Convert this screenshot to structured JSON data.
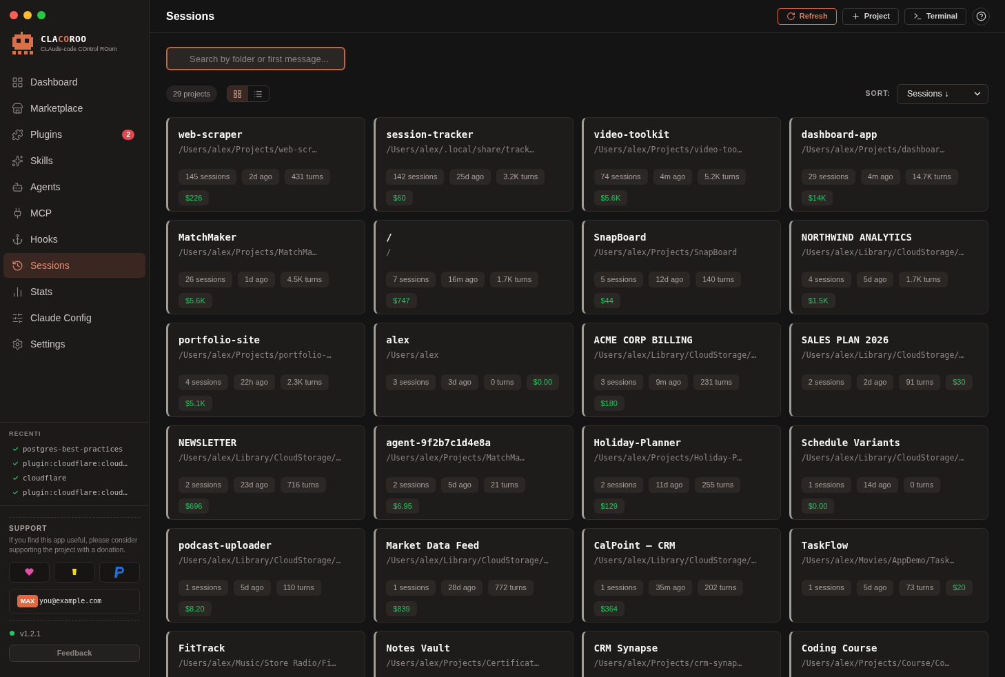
{
  "app": {
    "title_parts": [
      {
        "text": "CLA",
        "accent": false
      },
      {
        "text": "CO",
        "accent": true
      },
      {
        "text": "ROO",
        "accent": false
      }
    ],
    "subtitle": "CLAude-code COntrol ROom"
  },
  "sidebar": {
    "items": [
      {
        "label": "Dashboard",
        "selected": false
      },
      {
        "label": "Marketplace",
        "selected": false
      },
      {
        "label": "Plugins",
        "selected": false,
        "badge": "2"
      },
      {
        "label": "Skills",
        "selected": false
      },
      {
        "label": "Agents",
        "selected": false
      },
      {
        "label": "MCP",
        "selected": false
      },
      {
        "label": "Hooks",
        "selected": false
      },
      {
        "label": "Sessions",
        "selected": true
      },
      {
        "label": "Stats",
        "selected": false
      },
      {
        "label": "Claude Config",
        "selected": false
      },
      {
        "label": "Settings",
        "selected": false
      }
    ],
    "recent": {
      "title": "RECENTI",
      "items": [
        "postgres-best-practices",
        "plugin:cloudflare:cloud…",
        "cloudflare",
        "plugin:cloudflare:cloud…"
      ]
    },
    "support": {
      "title": "SUPPORT",
      "text": "If you find this app useful, please consider supporting the project with a donation."
    },
    "account": {
      "plan": "MAX",
      "email": "you@example.com"
    },
    "version": "v1.2.1",
    "feedback": "Feedback"
  },
  "header": {
    "title": "Sessions",
    "buttons": [
      {
        "label": "Refresh",
        "kind": "refresh"
      },
      {
        "label": "Project",
        "kind": "add"
      },
      {
        "label": "Terminal",
        "kind": "terminal"
      }
    ]
  },
  "search": {
    "placeholder": "Search by folder or first message..."
  },
  "toolbar": {
    "count": "29 projects",
    "views": [
      {
        "kind": "grid",
        "selected": true
      },
      {
        "kind": "list",
        "selected": false
      }
    ],
    "sort_label": "SORT:",
    "sort_value": "Sessions ↓"
  },
  "projects": [
    {
      "name": "web-scraper",
      "path": "/Users/alex/Projects/web-scr…",
      "sessions": "145 sessions",
      "ago": "2d ago",
      "turns": "431 turns",
      "cost": "$226"
    },
    {
      "name": "session-tracker",
      "path": "/Users/alex/.local/share/track…",
      "sessions": "142 sessions",
      "ago": "25d ago",
      "turns": "3.2K turns",
      "cost": "$60"
    },
    {
      "name": "video-toolkit",
      "path": "/Users/alex/Projects/video-too…",
      "sessions": "74 sessions",
      "ago": "4m ago",
      "turns": "5.2K turns",
      "cost": "$5.6K"
    },
    {
      "name": "dashboard-app",
      "path": "/Users/alex/Projects/dashboar…",
      "sessions": "29 sessions",
      "ago": "4m ago",
      "turns": "14.7K turns",
      "cost": "$14K"
    },
    {
      "name": "MatchMaker",
      "path": "/Users/alex/Projects/MatchMa…",
      "sessions": "26 sessions",
      "ago": "1d ago",
      "turns": "4.5K turns",
      "cost": "$5.6K"
    },
    {
      "name": "/",
      "path": "/",
      "sessions": "7 sessions",
      "ago": "16m ago",
      "turns": "1.7K turns",
      "cost": "$747"
    },
    {
      "name": "SnapBoard",
      "path": "/Users/alex/Projects/SnapBoard",
      "sessions": "5 sessions",
      "ago": "12d ago",
      "turns": "140 turns",
      "cost": "$44"
    },
    {
      "name": "NORTHWIND ANALYTICS",
      "path": "/Users/alex/Library/CloudStorage/…",
      "sessions": "4 sessions",
      "ago": "5d ago",
      "turns": "1.7K turns",
      "cost": "$1.5K"
    },
    {
      "name": "portfolio-site",
      "path": "/Users/alex/Projects/portfolio-…",
      "sessions": "4 sessions",
      "ago": "22h ago",
      "turns": "2.3K turns",
      "cost": "$5.1K"
    },
    {
      "name": "alex",
      "path": "/Users/alex",
      "sessions": "3 sessions",
      "ago": "3d ago",
      "turns": "0 turns",
      "cost": "$0.00"
    },
    {
      "name": "ACME CORP BILLING",
      "path": "/Users/alex/Library/CloudStorage/…",
      "sessions": "3 sessions",
      "ago": "9m ago",
      "turns": "231 turns",
      "cost": "$180"
    },
    {
      "name": "SALES PLAN 2026",
      "path": "/Users/alex/Library/CloudStorage/…",
      "sessions": "2 sessions",
      "ago": "2d ago",
      "turns": "91 turns",
      "cost": "$30"
    },
    {
      "name": "NEWSLETTER",
      "path": "/Users/alex/Library/CloudStorage/…",
      "sessions": "2 sessions",
      "ago": "23d ago",
      "turns": "716 turns",
      "cost": "$696"
    },
    {
      "name": "agent-9f2b7c1d4e8a",
      "path": "/Users/alex/Projects/MatchMa…",
      "sessions": "2 sessions",
      "ago": "5d ago",
      "turns": "21 turns",
      "cost": "$6.95"
    },
    {
      "name": "Holiday-Planner",
      "path": "/Users/alex/Projects/Holiday-P…",
      "sessions": "2 sessions",
      "ago": "11d ago",
      "turns": "255 turns",
      "cost": "$129"
    },
    {
      "name": "Schedule Variants",
      "path": "/Users/alex/Library/CloudStorage/…",
      "sessions": "1 sessions",
      "ago": "14d ago",
      "turns": "0 turns",
      "cost": "$0.00"
    },
    {
      "name": "podcast-uploader",
      "path": "/Users/alex/Library/CloudStorage/…",
      "sessions": "1 sessions",
      "ago": "5d ago",
      "turns": "110 turns",
      "cost": "$8.20"
    },
    {
      "name": "Market Data Feed",
      "path": "/Users/alex/Library/CloudStorage/…",
      "sessions": "1 sessions",
      "ago": "28d ago",
      "turns": "772 turns",
      "cost": "$839"
    },
    {
      "name": "CalPoint – CRM",
      "path": "/Users/alex/Library/CloudStorage/…",
      "sessions": "1 sessions",
      "ago": "35m ago",
      "turns": "202 turns",
      "cost": "$364"
    },
    {
      "name": "TaskFlow",
      "path": "/Users/alex/Movies/AppDemo/Task…",
      "sessions": "1 sessions",
      "ago": "5d ago",
      "turns": "73 turns",
      "cost": "$20"
    },
    {
      "name": "FitTrack",
      "path": "/Users/alex/Music/Store Radio/Fi…"
    },
    {
      "name": "Notes Vault",
      "path": "/Users/alex/Projects/Certificat…"
    },
    {
      "name": "CRM Synapse",
      "path": "/Users/alex/Projects/crm-synap…"
    },
    {
      "name": "Coding Course",
      "path": "/Users/alex/Projects/Course/Co…"
    }
  ]
}
